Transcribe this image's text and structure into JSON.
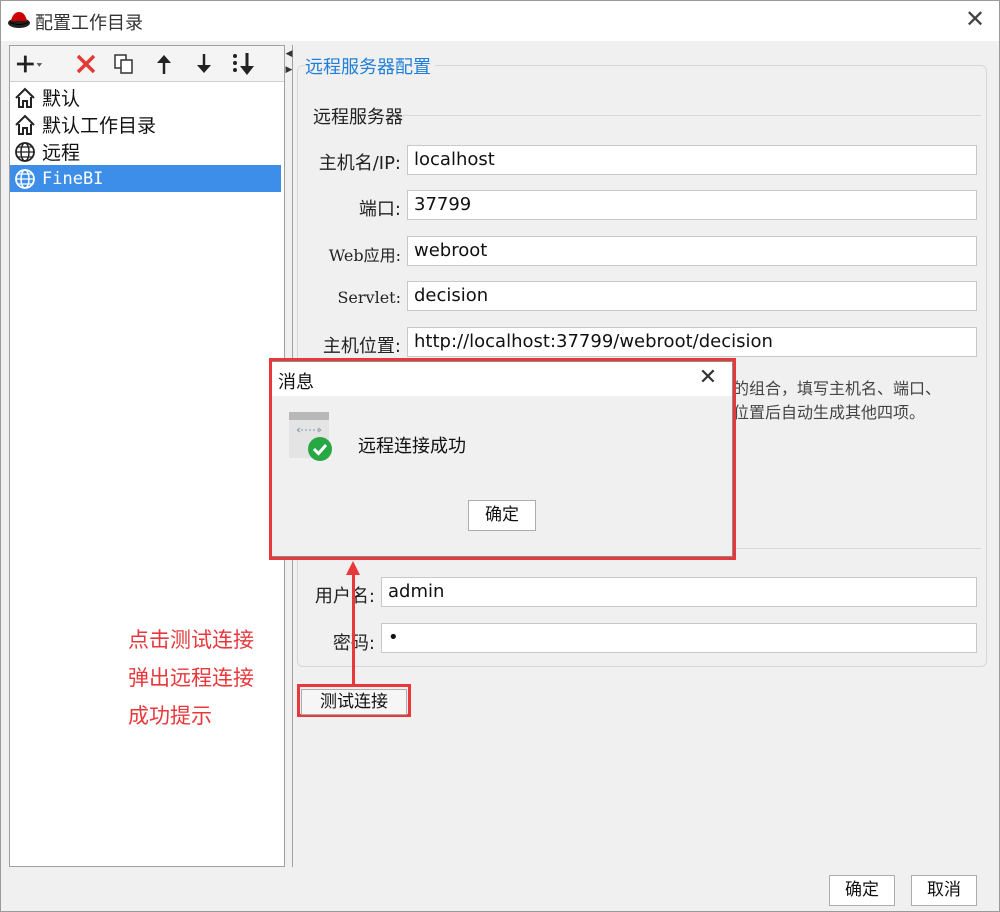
{
  "window": {
    "title": "配置工作目录"
  },
  "tree": {
    "items": [
      {
        "label": "默认",
        "icon": "home-icon"
      },
      {
        "label": "默认工作目录",
        "icon": "home-icon"
      },
      {
        "label": "远程",
        "icon": "globe-icon"
      },
      {
        "label": "FineBI",
        "icon": "globe-icon",
        "selected": true
      }
    ]
  },
  "toolbar": {
    "icons": [
      "add-icon",
      "delete-icon",
      "copy-icon",
      "move-up-icon",
      "move-down-icon",
      "sort-icon"
    ]
  },
  "panel": {
    "section_title": "远程服务器配置",
    "subsection_title": "远程服务器",
    "fields": {
      "host_label": "主机名/IP:",
      "host_value": "localhost",
      "port_label": "端口:",
      "port_value": "37799",
      "webapp_label": "Web应用:",
      "webapp_value": "webroot",
      "servlet_label": "Servlet:",
      "servlet_value": "decision",
      "location_label": "主机位置:",
      "location_value": "http://localhost:37799/webroot/decision"
    },
    "hint_line1": "的组合，填写主机名、端口、",
    "hint_line2": "位置后自动生成其他四项。",
    "username_label": "用户名:",
    "username_value": "admin",
    "password_label": "密码:",
    "password_value": "•",
    "test_button": "测试连接"
  },
  "dialog": {
    "title": "消息",
    "message": "远程连接成功",
    "ok_label": "确定"
  },
  "annotation": {
    "line1": "点击测试连接",
    "line2": "弹出远程连接",
    "line3": "成功提示"
  },
  "buttons": {
    "ok": "确定",
    "cancel": "取消"
  },
  "colors": {
    "accent": "#1f7fd8",
    "selection": "#3d8ee8",
    "annotation_red": "#e8383b"
  }
}
